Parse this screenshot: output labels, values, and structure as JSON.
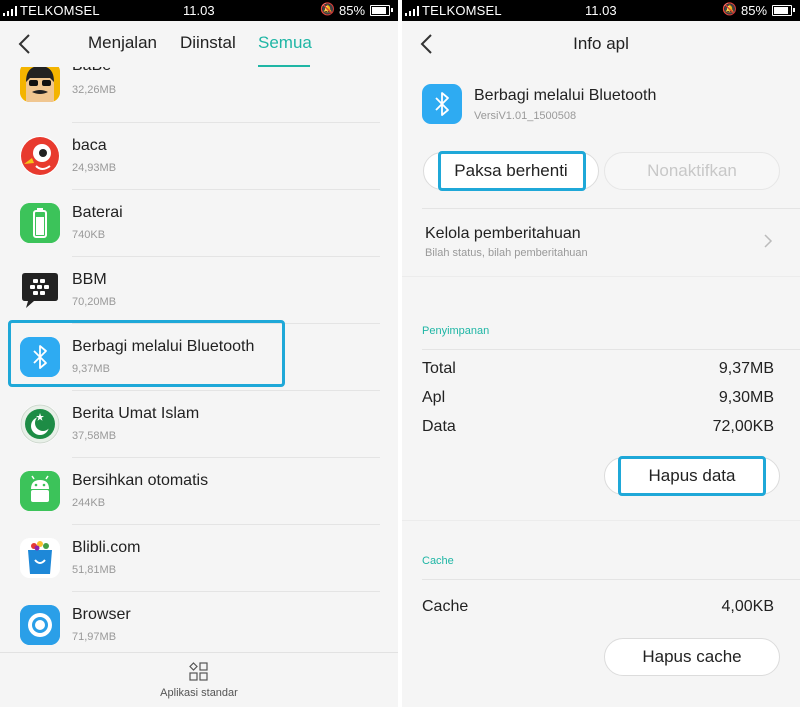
{
  "status_bar": {
    "carrier": "TELKOMSEL",
    "time": "11.03",
    "battery_pct": "85%",
    "battery_level": 0.85
  },
  "left": {
    "tabs": [
      {
        "label": "Menjalan"
      },
      {
        "label": "Diinstal"
      },
      {
        "label": "Semua"
      }
    ],
    "active_tab": "Semua",
    "apps": [
      {
        "name": "BaBe",
        "size": "32,26MB",
        "icon": "babe-icon"
      },
      {
        "name": "baca",
        "size": "24,93MB",
        "icon": "baca-bird-icon"
      },
      {
        "name": "Baterai",
        "size": "740KB",
        "icon": "battery-app-icon"
      },
      {
        "name": "BBM",
        "size": "70,20MB",
        "icon": "bbm-icon"
      },
      {
        "name": "Berbagi melalui Bluetooth",
        "size": "9,37MB",
        "icon": "bluetooth-icon"
      },
      {
        "name": "Berita Umat Islam",
        "size": "37,58MB",
        "icon": "crescent-moon-icon"
      },
      {
        "name": "Bersihkan otomatis",
        "size": "244KB",
        "icon": "android-robot-icon"
      },
      {
        "name": "Blibli.com",
        "size": "51,81MB",
        "icon": "shopping-bag-icon"
      },
      {
        "name": "Browser",
        "size": "71,97MB",
        "icon": "browser-icon"
      }
    ],
    "bottom_label": "Aplikasi standar"
  },
  "right": {
    "title": "Info apl",
    "app_name": "Berbagi melalui Bluetooth",
    "version": "VersiV1.01_1500508",
    "force_stop_label": "Paksa berhenti",
    "disable_label": "Nonaktifkan",
    "notifications_title": "Kelola pemberitahuan",
    "notifications_sub": "Bilah status, bilah pemberitahuan",
    "storage_section": "Penyimpanan",
    "storage": [
      {
        "label": "Total",
        "value": "9,37MB"
      },
      {
        "label": "Apl",
        "value": "9,30MB"
      },
      {
        "label": "Data",
        "value": "72,00KB"
      }
    ],
    "clear_data_label": "Hapus data",
    "cache_section": "Cache",
    "cache_label": "Cache",
    "cache_value": "4,00KB",
    "clear_cache_label": "Hapus cache"
  },
  "colors": {
    "accent": "#1fb6a5",
    "highlight": "#1fa8d8",
    "bluetooth": "#2eabf2"
  }
}
